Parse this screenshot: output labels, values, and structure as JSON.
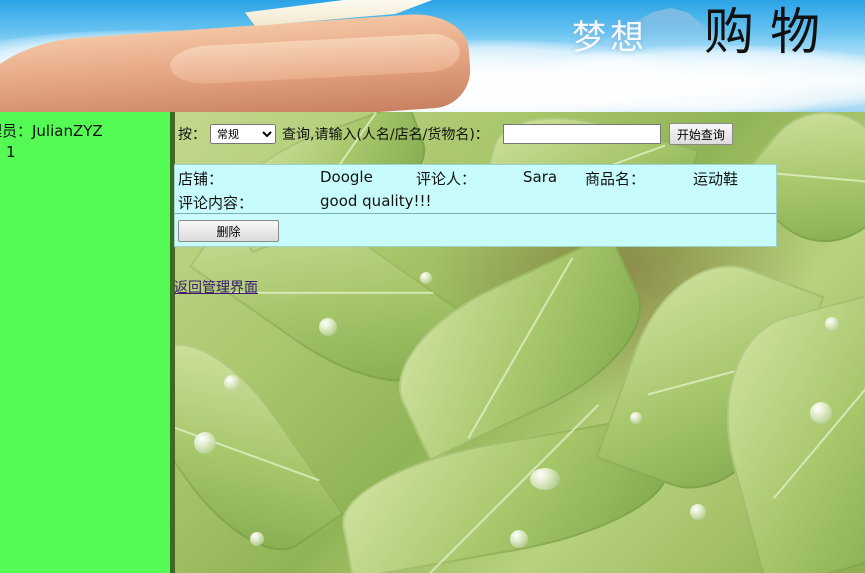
{
  "banner": {
    "title_light": "梦想",
    "title_dark": "购物"
  },
  "sidebar": {
    "admin_label": "理员：JulianZYZ",
    "count": "1"
  },
  "search": {
    "by_label": "按：",
    "mode_options": [
      "常规"
    ],
    "mode_selected": "常规",
    "prompt": "查询,请输入(人名/店名/货物名)：",
    "input_value": "",
    "submit_label": "开始查询"
  },
  "review": {
    "shop_label": "店铺：",
    "shop_value": "Doogle",
    "reviewer_label": "评论人：",
    "reviewer_value": "Sara",
    "product_label": "商品名：",
    "product_value": "运动鞋",
    "content_label": "评论内容：",
    "content_value": "good quality!!!",
    "delete_label": "删除"
  },
  "back_link": "返回管理界面",
  "colors": {
    "sidebar": "#55fb55",
    "review_panel": "#c8fcfc"
  }
}
